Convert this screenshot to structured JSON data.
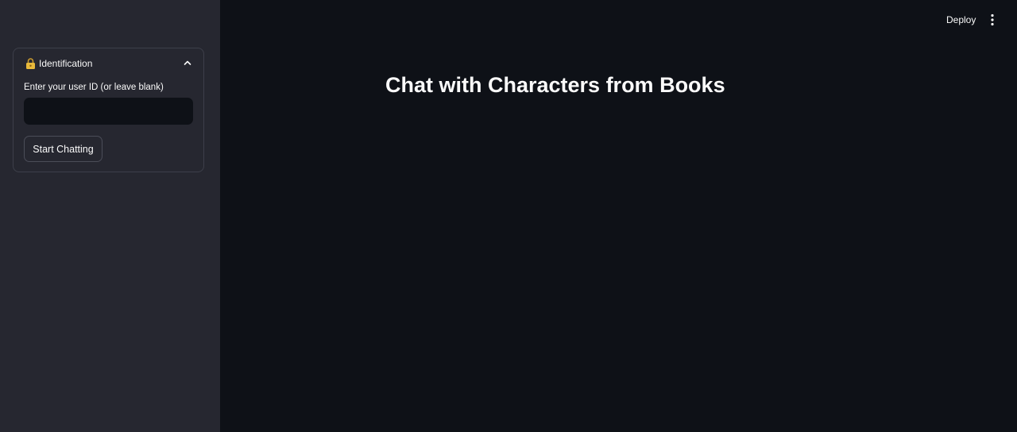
{
  "header": {
    "deploy_label": "Deploy",
    "menu_icon": "kebab-menu-icon"
  },
  "sidebar": {
    "expander": {
      "icon": "lock-icon",
      "title": "Identification",
      "expanded": true,
      "toggle_icon": "chevron-up-icon"
    },
    "user_id_field": {
      "label": "Enter your user ID (or leave blank)",
      "value": "",
      "placeholder": ""
    },
    "start_button_label": "Start Chatting"
  },
  "main": {
    "title": "Chat with Characters from Books"
  },
  "colors": {
    "main_bg": "#0e1117",
    "sidebar_bg": "#262730",
    "text": "#fafafa",
    "lock_icon": "#e8b93b"
  }
}
